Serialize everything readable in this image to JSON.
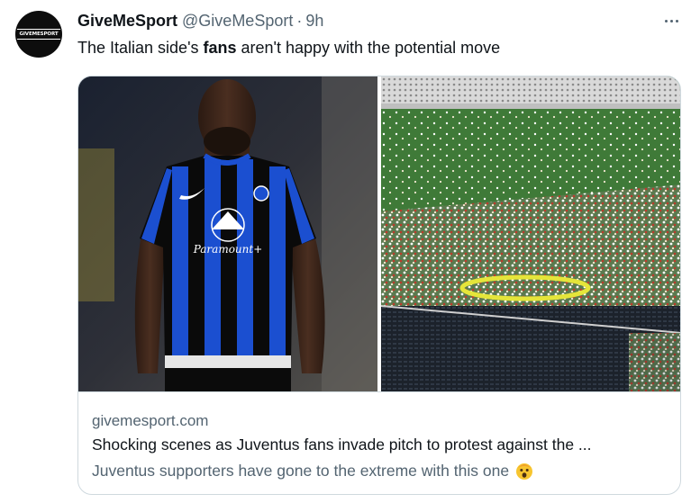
{
  "account": {
    "avatar_text": "GIVEMESPORT",
    "display_name": "GiveMeSport",
    "handle": "@GiveMeSport",
    "separator": "·",
    "time": "9h"
  },
  "tweet": {
    "text_before": "The Italian side's ",
    "text_bold": "fans",
    "text_after": " aren't happy with the potential move"
  },
  "link_card": {
    "domain": "givemesport.com",
    "title": "Shocking scenes as Juventus fans invade pitch to protest against the ...",
    "description": "Juventus supporters have gone to the extreme with this one",
    "description_emoji": "astonished-face-emoji"
  },
  "jersey": {
    "sponsor": "Paramount+"
  },
  "colors": {
    "text_primary": "#0f1419",
    "text_secondary": "#536471",
    "border": "#cfd9de",
    "inter_blue": "#1b4fd0",
    "inter_black": "#0a0a0a",
    "pitch_green": "#3f7a38"
  },
  "icons": {
    "more": "more-horizontal-icon"
  }
}
